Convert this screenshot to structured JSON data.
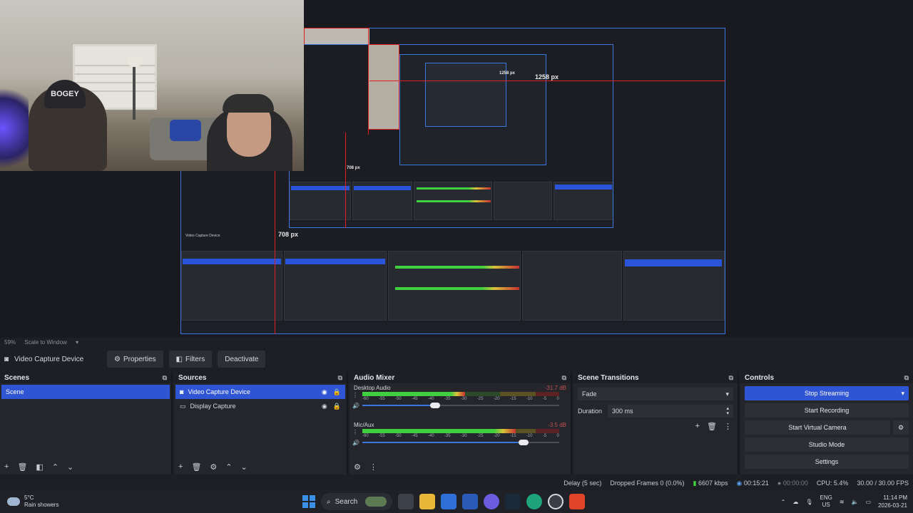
{
  "window_controls": {
    "minimize": "─",
    "maximize": "❐",
    "close": "✕"
  },
  "preview": {
    "webcam_cap_text": "BOGEY",
    "measure_h": "1258 px",
    "measure_h_small": "1258 px",
    "measure_v": "708 px",
    "measure_v_small": "708 px",
    "status": {
      "zoom": "59%",
      "scale": "Scale to Window"
    }
  },
  "source_toolbar": {
    "source_name": "Video Capture Device",
    "properties": "Properties",
    "filters": "Filters",
    "deactivate": "Deactivate"
  },
  "scenes": {
    "title": "Scenes",
    "items": [
      {
        "label": "Scene",
        "selected": true
      }
    ]
  },
  "sources": {
    "title": "Sources",
    "items": [
      {
        "label": "Video Capture Device",
        "selected": true
      },
      {
        "label": "Display Capture",
        "selected": false
      }
    ]
  },
  "mixer": {
    "title": "Audio Mixer",
    "ticks": [
      "-60",
      "-55",
      "-50",
      "-45",
      "-40",
      "-35",
      "-30",
      "-25",
      "-20",
      "-15",
      "-10",
      "-5",
      "0"
    ],
    "channels": [
      {
        "name": "Desktop Audio",
        "db": "-31.7 dB",
        "level": 0.52,
        "volume": 0.37
      },
      {
        "name": "Mic/Aux",
        "db": "-3.5 dB",
        "level": 0.78,
        "volume": 0.82
      }
    ]
  },
  "transitions": {
    "title": "Scene Transitions",
    "selected": "Fade",
    "duration_label": "Duration",
    "duration_value": "300 ms"
  },
  "controls": {
    "title": "Controls",
    "stop_streaming": "Stop Streaming",
    "start_recording": "Start Recording",
    "start_virtual_camera": "Start Virtual Camera",
    "studio_mode": "Studio Mode",
    "settings": "Settings"
  },
  "status_bar": {
    "delay": "Delay (5 sec)",
    "dropped": "Dropped Frames 0 (0.0%)",
    "bitrate": "6607 kbps",
    "stream_time": "00:15:21",
    "rec_time": "00:00:00",
    "cpu": "CPU: 5.4%",
    "fps": "30.00 / 30.00 FPS"
  },
  "taskbar": {
    "weather_temp": "5°C",
    "weather_desc": "Rain showers",
    "search": "Search",
    "lang1": "ENG",
    "lang2": "US",
    "time": "11:14 PM",
    "date": "2026-03-21"
  },
  "colors": {
    "accent": "#2f55d4",
    "meter_green": "#3fcf3f",
    "meter_yellow": "#d9c23a",
    "meter_red": "#c83030",
    "measure_red": "#e02020",
    "preview_border": "#3a78e0"
  }
}
